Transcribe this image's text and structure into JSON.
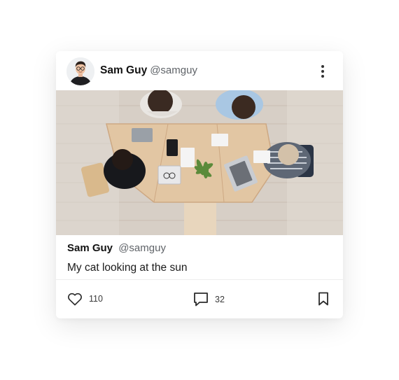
{
  "post": {
    "author": {
      "name": "Sam Guy",
      "handle": "@samguy"
    },
    "caption": {
      "author_name": "Sam Guy",
      "author_handle": "@samguy",
      "text": "My cat looking at the sun"
    },
    "stats": {
      "likes": "110",
      "comments": "32"
    }
  },
  "icons": {
    "more": "more-vertical-icon",
    "like": "heart-icon",
    "comment": "comment-icon",
    "save": "bookmark-icon"
  },
  "colors": {
    "text_primary": "#121212",
    "text_secondary": "#5f6368",
    "icon": "#2b2b2b"
  }
}
